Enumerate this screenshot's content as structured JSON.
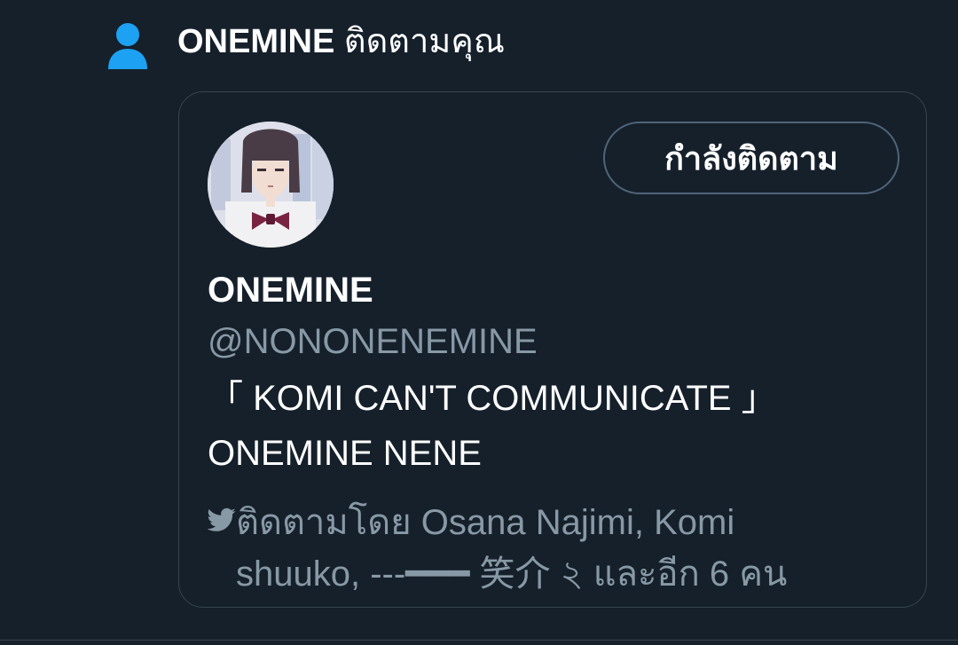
{
  "notification": {
    "icon": "person-icon",
    "follower_name": "ONEMINE",
    "action_text": "ติดตามคุณ"
  },
  "card": {
    "follow_button_label": "กำลังติดตาม",
    "display_name": "ONEMINE",
    "handle": "@NONONENEMINE",
    "bio_line1": "「 KOMI CAN'T COMMUNICATE 」",
    "bio_line2": "ONEMINE NENE",
    "followed_by_line1": "ติดตามโดย Osana Najimi, Komi",
    "followed_by_line2": "shuuko, ---━━━ 笑介 ২ และอีก 6 คน",
    "followed_by_icon": "bird-icon"
  },
  "colors": {
    "background": "#15202b",
    "border": "#38444d",
    "secondary_text": "#8899a6",
    "accent": "#1da1f2"
  }
}
